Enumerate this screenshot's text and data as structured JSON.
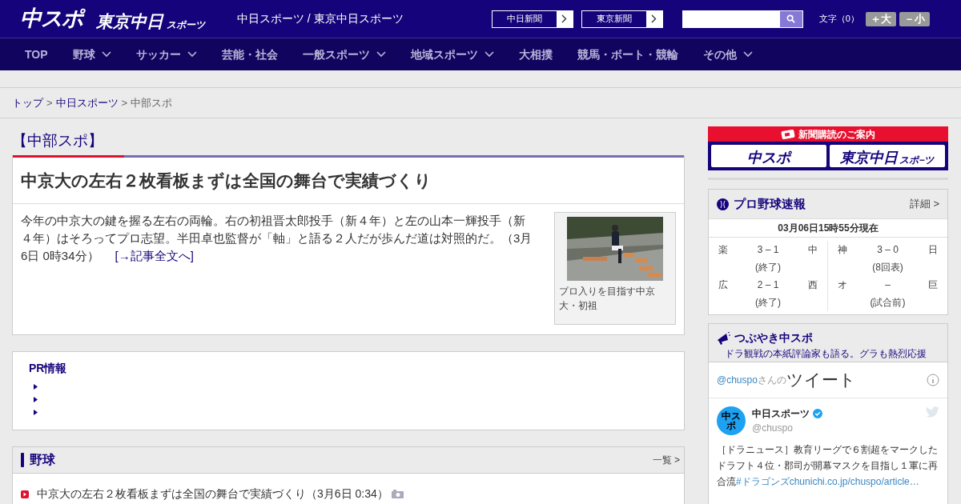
{
  "header": {
    "logo_main": "中スポ",
    "logo_tokyo": "東京中日",
    "logo_tokyo_sub": "スポーツ",
    "site_title": "中日スポーツ / 東京中日スポーツ",
    "paper_links": [
      "中日新聞",
      "東京新聞"
    ],
    "font_label": "文字（0）",
    "font_buttons": [
      "＋大",
      "－小"
    ]
  },
  "nav": [
    {
      "label": "TOP",
      "dropdown": false
    },
    {
      "label": "野球",
      "dropdown": true
    },
    {
      "label": "サッカー",
      "dropdown": true
    },
    {
      "label": "芸能・社会",
      "dropdown": false
    },
    {
      "label": "一般スポーツ",
      "dropdown": true
    },
    {
      "label": "地域スポーツ",
      "dropdown": true
    },
    {
      "label": "大相撲",
      "dropdown": false
    },
    {
      "label": "競馬・ボート・競輪",
      "dropdown": false
    },
    {
      "label": "その他",
      "dropdown": true
    }
  ],
  "breadcrumb_separator": ">",
  "breadcrumb": [
    {
      "label": "トップ",
      "link": true
    },
    {
      "label": "中日スポーツ",
      "link": true
    },
    {
      "label": "中部スポ",
      "link": false
    }
  ],
  "section_title": "【中部スポ】",
  "article": {
    "title": "中京大の左右２枚看板まずは全国の舞台で実績づくり",
    "body": "今年の中京大の鍵を握る左右の両輪。右の初祖晋太郎投手（新４年）と左の山本一輝投手（新４年）はそろってプロ志望。半田卓也監督が「軸」と語る２人だが歩んだ道は対照的だ。（3月6日 0時34分）",
    "more_link": "[→記事全文へ]",
    "photo_caption": "プロ入りを目指す中京大・初祖"
  },
  "pr": {
    "title": "PR情報"
  },
  "baseball": {
    "title": "野球",
    "list_link": "一覧 >",
    "items": [
      {
        "text": "中京大の左右２枚看板まずは全国の舞台で実績づくり（3月6日 0:34）",
        "has_photo": true
      }
    ]
  },
  "subscription": {
    "title": "新聞購読のご案内",
    "logos": [
      "中スポ",
      "東京中日"
    ],
    "logo_sub": "スポ−ツ"
  },
  "scores": {
    "title": "プロ野球速報",
    "detail_link": "詳細 >",
    "timestamp": "03月06日15時55分現在",
    "games": [
      {
        "home": "楽",
        "score": "3 – 1",
        "away": "中",
        "status": "(終了)"
      },
      {
        "home": "神",
        "score": "3 – 0",
        "away": "日",
        "status": "(8回表)"
      },
      {
        "home": "広",
        "score": "2 – 1",
        "away": "西",
        "status": "(終了)"
      },
      {
        "home": "オ",
        "score": "–",
        "away": "巨",
        "status": "(試合前)"
      }
    ]
  },
  "tweets": {
    "title": "つぶやき中スポ",
    "subtitle": "ドラ観戦の本紙評論家も語る。グラも熱烈応援",
    "handle_link": "@chuspo",
    "handle_suffix": "さんの",
    "heading": "ツイート",
    "tweet": {
      "avatar": "中スポ",
      "name": "中日スポーツ",
      "verified": true,
      "handle": "@chuspo",
      "text": "［ドラニュース］教育リーグで６割超をマークしたドラフト４位・郡司が開幕マスクを目指し１軍に再合流",
      "hashtag": "#ドラゴンズ",
      "link": "chunichi.co.jp/chuspo/article…"
    }
  }
}
